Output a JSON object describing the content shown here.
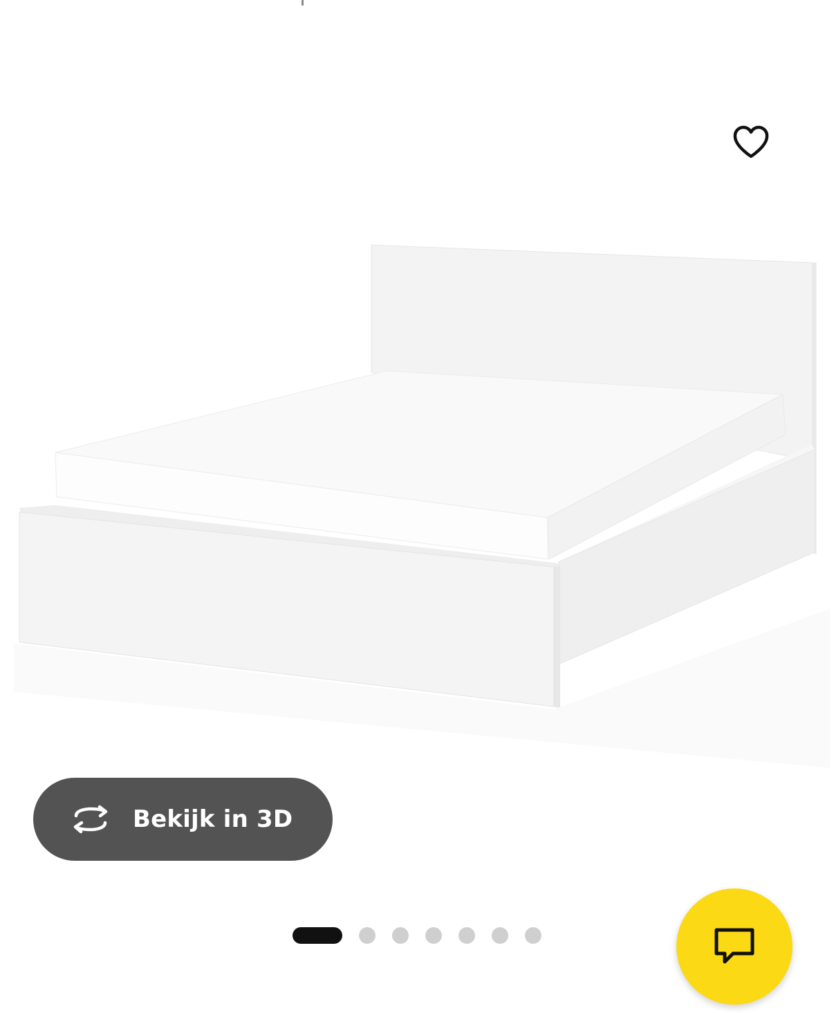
{
  "favorite": {
    "icon": "heart-outline-icon"
  },
  "product_image": {
    "alt": ""
  },
  "view_3d": {
    "label": "Bekijk in 3D",
    "icon": "rotate-3d-icon"
  },
  "carousel": {
    "total": 7,
    "active_index": 0
  },
  "chat": {
    "icon": "chat-bubble-icon"
  },
  "colors": {
    "view3d_bg": "#535353",
    "chat_bg": "#fbd914",
    "dot_active": "#111111",
    "dot_inactive": "#cfcfcf"
  }
}
